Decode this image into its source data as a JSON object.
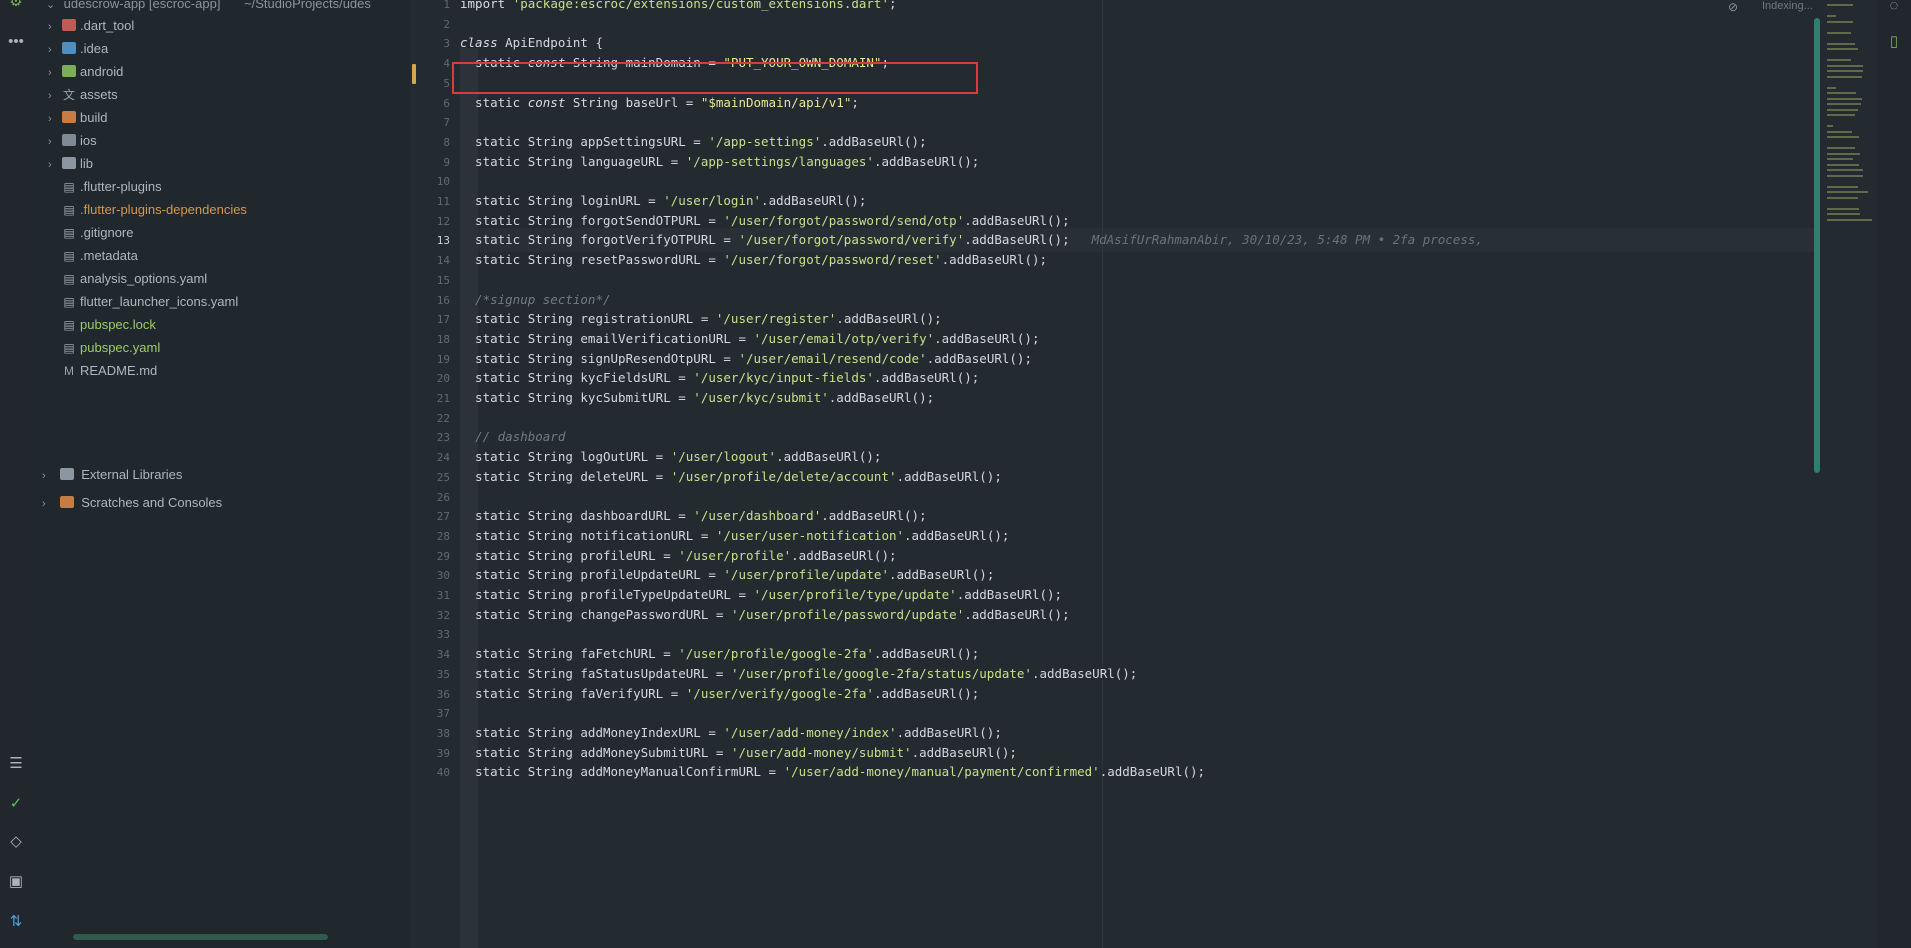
{
  "project_tree": {
    "root_label": "udescrow-app [escroc-app]",
    "root_path": "~/StudioProjects/udes",
    "items": [
      {
        "label": ".dart_tool",
        "kind": "folder-red",
        "expandable": true
      },
      {
        "label": ".idea",
        "kind": "folder-blue",
        "expandable": true
      },
      {
        "label": "android",
        "kind": "folder-green",
        "expandable": true
      },
      {
        "label": "assets",
        "kind": "folder-translate",
        "expandable": true
      },
      {
        "label": "build",
        "kind": "folder-orange",
        "expandable": true
      },
      {
        "label": "ios",
        "kind": "folder-grey",
        "expandable": true
      },
      {
        "label": "lib",
        "kind": "folder-lib",
        "expandable": true
      },
      {
        "label": ".flutter-plugins",
        "kind": "file"
      },
      {
        "label": ".flutter-plugins-dependencies",
        "kind": "file-orange"
      },
      {
        "label": ".gitignore",
        "kind": "file"
      },
      {
        "label": ".metadata",
        "kind": "file"
      },
      {
        "label": "analysis_options.yaml",
        "kind": "yaml"
      },
      {
        "label": "flutter_launcher_icons.yaml",
        "kind": "yaml"
      },
      {
        "label": "pubspec.lock",
        "kind": "file-green"
      },
      {
        "label": "pubspec.yaml",
        "kind": "yaml-green"
      },
      {
        "label": "README.md",
        "kind": "md"
      }
    ],
    "external_libraries": "External Libraries",
    "scratches": "Scratches and Consoles"
  },
  "editor": {
    "status": "Indexing...",
    "current_line": 13,
    "blame": "MdAsifUrRahmanAbir, 30/10/23, 5:48 PM • 2fa process,",
    "line_numbers": [
      "1",
      "2",
      "3",
      "4",
      "5",
      "6",
      "7",
      "8",
      "9",
      "10",
      "11",
      "12",
      "13",
      "14",
      "15",
      "16",
      "17",
      "18",
      "19",
      "20",
      "21",
      "22",
      "23",
      "24",
      "25",
      "26",
      "27",
      "28",
      "29",
      "30",
      "31",
      "32",
      "33",
      "34",
      "35",
      "36",
      "37",
      "38",
      "39",
      "40"
    ],
    "lines": [
      [
        [
          "kw",
          "import "
        ],
        [
          "str",
          "'package:escroc/extensions/custom_extensions.dart'"
        ],
        [
          "",
          ";"
        ]
      ],
      [],
      [
        [
          "kwi",
          "class "
        ],
        [
          "",
          "ApiEndpoint {"
        ]
      ],
      [
        [
          "",
          "  static "
        ],
        [
          "kwi",
          "const "
        ],
        [
          "",
          "String mainDomain = "
        ],
        [
          "strd",
          "\"PUT_YOUR_OWN_DOMAIN\""
        ],
        [
          "",
          ";"
        ]
      ],
      [],
      [
        [
          "",
          "  static "
        ],
        [
          "kwi",
          "const "
        ],
        [
          "",
          "String baseUrl = "
        ],
        [
          "strd",
          "\"$mainDomain/api/v1\""
        ],
        [
          "",
          ";"
        ]
      ],
      [],
      [
        [
          "",
          "  static String appSettingsURL = "
        ],
        [
          "str",
          "'/app-settings'"
        ],
        [
          "",
          ".addBaseURl();"
        ]
      ],
      [
        [
          "",
          "  static String languageURL = "
        ],
        [
          "str",
          "'/app-settings/languages'"
        ],
        [
          "",
          ".addBaseURl();"
        ]
      ],
      [],
      [
        [
          "",
          "  static String loginURL = "
        ],
        [
          "str",
          "'/user/login'"
        ],
        [
          "",
          ".addBaseURl();"
        ]
      ],
      [
        [
          "",
          "  static String forgotSendOTPURL = "
        ],
        [
          "str",
          "'/user/forgot/password/send/otp'"
        ],
        [
          "",
          ".addBaseURl();"
        ]
      ],
      [
        [
          "",
          "  static String forgotVerifyOTPURL = "
        ],
        [
          "str",
          "'/user/forgot/password/verify'"
        ],
        [
          "",
          ".addBaseURl();"
        ]
      ],
      [
        [
          "",
          "  static String resetPasswordURL = "
        ],
        [
          "str",
          "'/user/forgot/password/reset'"
        ],
        [
          "",
          ".addBaseURl();"
        ]
      ],
      [],
      [
        [
          "cmt",
          "  /*signup section*/"
        ]
      ],
      [
        [
          "",
          "  static String registrationURL = "
        ],
        [
          "str",
          "'/user/register'"
        ],
        [
          "",
          ".addBaseURl();"
        ]
      ],
      [
        [
          "",
          "  static String emailVerificationURL = "
        ],
        [
          "str",
          "'/user/email/otp/verify'"
        ],
        [
          "",
          ".addBaseURl();"
        ]
      ],
      [
        [
          "",
          "  static String signUpResendOtpURL = "
        ],
        [
          "str",
          "'/user/email/resend/code'"
        ],
        [
          "",
          ".addBaseURl();"
        ]
      ],
      [
        [
          "",
          "  static String kycFieldsURL = "
        ],
        [
          "str",
          "'/user/kyc/input-fields'"
        ],
        [
          "",
          ".addBaseURl();"
        ]
      ],
      [
        [
          "",
          "  static String kycSubmitURL = "
        ],
        [
          "str",
          "'/user/kyc/submit'"
        ],
        [
          "",
          ".addBaseURl();"
        ]
      ],
      [],
      [
        [
          "cmt",
          "  // dashboard"
        ]
      ],
      [
        [
          "",
          "  static String logOutURL = "
        ],
        [
          "str",
          "'/user/logout'"
        ],
        [
          "",
          ".addBaseURl();"
        ]
      ],
      [
        [
          "",
          "  static String deleteURL = "
        ],
        [
          "str",
          "'/user/profile/delete/account'"
        ],
        [
          "",
          ".addBaseURl();"
        ]
      ],
      [],
      [
        [
          "",
          "  static String dashboardURL = "
        ],
        [
          "str",
          "'/user/dashboard'"
        ],
        [
          "",
          ".addBaseURl();"
        ]
      ],
      [
        [
          "",
          "  static String notificationURL = "
        ],
        [
          "str",
          "'/user/user-notification'"
        ],
        [
          "",
          ".addBaseURl();"
        ]
      ],
      [
        [
          "",
          "  static String profileURL = "
        ],
        [
          "str",
          "'/user/profile'"
        ],
        [
          "",
          ".addBaseURl();"
        ]
      ],
      [
        [
          "",
          "  static String profileUpdateURL = "
        ],
        [
          "str",
          "'/user/profile/update'"
        ],
        [
          "",
          ".addBaseURl();"
        ]
      ],
      [
        [
          "",
          "  static String profileTypeUpdateURL = "
        ],
        [
          "str",
          "'/user/profile/type/update'"
        ],
        [
          "",
          ".addBaseURl();"
        ]
      ],
      [
        [
          "",
          "  static String changePasswordURL = "
        ],
        [
          "str",
          "'/user/profile/password/update'"
        ],
        [
          "",
          ".addBaseURl();"
        ]
      ],
      [],
      [
        [
          "",
          "  static String faFetchURL = "
        ],
        [
          "str",
          "'/user/profile/google-2fa'"
        ],
        [
          "",
          ".addBaseURl();"
        ]
      ],
      [
        [
          "",
          "  static String faStatusUpdateURL = "
        ],
        [
          "str",
          "'/user/profile/google-2fa/status/update'"
        ],
        [
          "",
          ".addBaseURl();"
        ]
      ],
      [
        [
          "",
          "  static String faVerifyURL = "
        ],
        [
          "str",
          "'/user/verify/google-2fa'"
        ],
        [
          "",
          ".addBaseURl();"
        ]
      ],
      [],
      [
        [
          "",
          "  static String addMoneyIndexURL = "
        ],
        [
          "str",
          "'/user/add-money/index'"
        ],
        [
          "",
          ".addBaseURl();"
        ]
      ],
      [
        [
          "",
          "  static String addMoneySubmitURL = "
        ],
        [
          "str",
          "'/user/add-money/submit'"
        ],
        [
          "",
          ".addBaseURl();"
        ]
      ],
      [
        [
          "",
          "  static String addMoneyManualConfirmURL = "
        ],
        [
          "str",
          "'/user/add-money/manual/payment/confirmed'"
        ],
        [
          "",
          ".addBaseURl();"
        ]
      ]
    ]
  },
  "icons": {
    "left_bar": [
      "project-icon",
      "more-icon",
      "structure-icon",
      "commit-check-icon",
      "flutter-inspector-icon",
      "terminal-icon",
      "pull-request-icon"
    ],
    "right_bar": [
      "notifications-icon",
      "device-manager-icon"
    ]
  },
  "colors": {
    "background": "#232a30",
    "highlight_box": "#dd3b3b",
    "string": "#c8e08a",
    "scrollbar": "#2f7f6a"
  }
}
